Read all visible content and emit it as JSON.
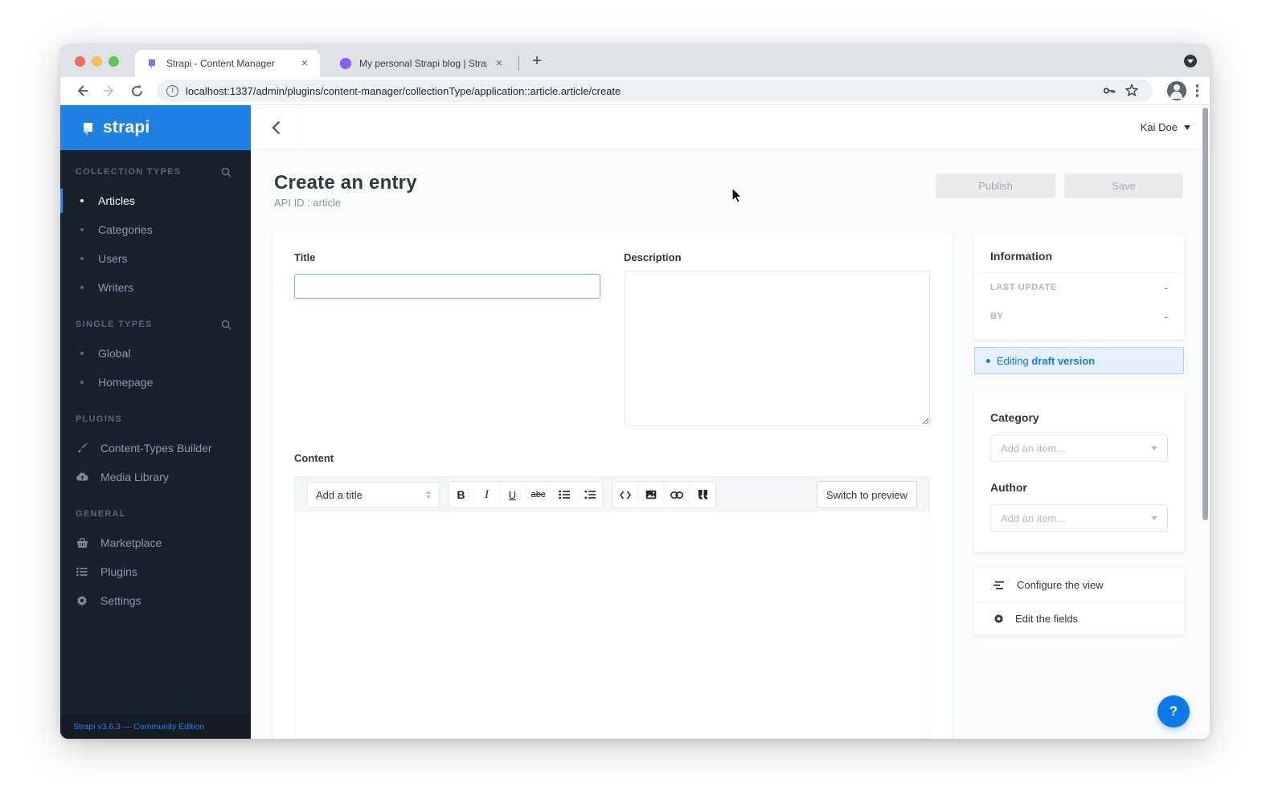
{
  "browser": {
    "tab1": {
      "title": "Strapi - Content Manager"
    },
    "tab2": {
      "title": "My personal Strapi blog | Strap"
    },
    "url": "localhost:1337/admin/plugins/content-manager/collectionType/application::article.article/create"
  },
  "sidebar": {
    "logo_text": "strapi",
    "sections": [
      {
        "title": "COLLECTION TYPES",
        "items": [
          {
            "label": "Articles",
            "active": true
          },
          {
            "label": "Categories"
          },
          {
            "label": "Users"
          },
          {
            "label": "Writers"
          }
        ]
      },
      {
        "title": "SINGLE TYPES",
        "items": [
          {
            "label": "Global"
          },
          {
            "label": "Homepage"
          }
        ]
      },
      {
        "title": "PLUGINS",
        "items": [
          {
            "label": "Content-Types Builder",
            "icon": "brush-icon"
          },
          {
            "label": "Media Library",
            "icon": "cloud-upload-icon"
          }
        ]
      },
      {
        "title": "GENERAL",
        "items": [
          {
            "label": "Marketplace",
            "icon": "basket-icon"
          },
          {
            "label": "Plugins",
            "icon": "list-icon"
          },
          {
            "label": "Settings",
            "icon": "gear-icon"
          }
        ]
      }
    ],
    "footer": "Strapi v3.6.3 — Community Edition"
  },
  "header": {
    "user": "Kai Doe"
  },
  "page": {
    "title": "Create an entry",
    "api_id": "API ID : article",
    "publish": "Publish",
    "save": "Save"
  },
  "form": {
    "title_label": "Title",
    "description_label": "Description",
    "content_label": "Content"
  },
  "editor": {
    "heading_select": "Add a title",
    "bold": "B",
    "italic": "I",
    "underline": "U",
    "strike": "abc",
    "switch_preview": "Switch to preview"
  },
  "info_panel": {
    "title": "Information",
    "last_update_label": "LAST UPDATE",
    "last_update_value": "-",
    "by_label": "BY",
    "by_value": "-"
  },
  "draft_banner": {
    "prefix": "Editing",
    "bold": "draft version"
  },
  "relations": {
    "category_label": "Category",
    "category_placeholder": "Add an item...",
    "author_label": "Author",
    "author_placeholder": "Add an item..."
  },
  "view_panel": {
    "configure": "Configure the view",
    "edit_fields": "Edit the fields"
  },
  "help_label": "?",
  "colors": {
    "accent_blue": "#0e7de7",
    "logo_blue": "#1e80e1",
    "sidebar_bg": "#1b212c",
    "draft_banner_bg": "#e6f0fc",
    "help_button": "#0e79e8"
  }
}
